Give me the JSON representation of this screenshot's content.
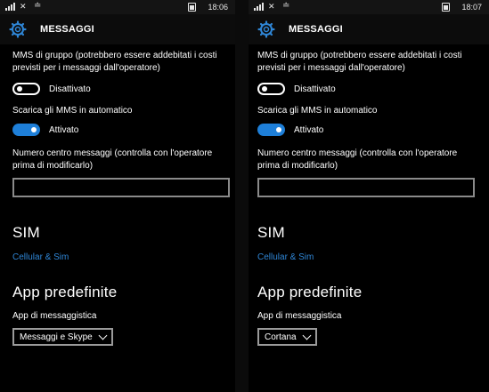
{
  "screens": [
    {
      "status": {
        "time": "18:06",
        "signal_icon": "signal-bars-icon",
        "nosim_icon": "no-sim-icon",
        "wifi_icon": "wifi-icon",
        "battery_icon": "battery-icon"
      },
      "header": {
        "title": "MESSAGGI",
        "icon": "gear-icon"
      },
      "group_mms": {
        "description": "MMS di gruppo (potrebbero essere addebitati i costi previsti per i messaggi dall'operatore)",
        "state": "Disattivato",
        "on": false
      },
      "auto_mms": {
        "description": "Scarica gli MMS in automatico",
        "state": "Attivato",
        "on": true
      },
      "center_number": {
        "description": "Numero centro messaggi (controlla con l'operatore prima di modificarlo)",
        "value": ""
      },
      "sim": {
        "heading": "SIM",
        "link": "Cellular & Sim"
      },
      "default_apps": {
        "heading": "App predefinite",
        "label": "App di messaggistica",
        "selected": "Messaggi e Skype"
      }
    },
    {
      "status": {
        "time": "18:07",
        "signal_icon": "signal-bars-icon",
        "nosim_icon": "no-sim-icon",
        "wifi_icon": "wifi-icon",
        "battery_icon": "battery-icon"
      },
      "header": {
        "title": "MESSAGGI",
        "icon": "gear-icon"
      },
      "group_mms": {
        "description": "MMS di gruppo (potrebbero essere addebitati i costi previsti per i messaggi dall'operatore)",
        "state": "Disattivato",
        "on": false
      },
      "auto_mms": {
        "description": "Scarica gli MMS in automatico",
        "state": "Attivato",
        "on": true
      },
      "center_number": {
        "description": "Numero centro messaggi (controlla con l'operatore prima di modificarlo)",
        "value": ""
      },
      "sim": {
        "heading": "SIM",
        "link": "Cellular & Sim"
      },
      "default_apps": {
        "heading": "App predefinite",
        "label": "App di messaggistica",
        "selected": "Cortana"
      }
    }
  ],
  "colors": {
    "accent": "#1e7fd8",
    "link": "#2f86d6",
    "background": "#000000"
  }
}
